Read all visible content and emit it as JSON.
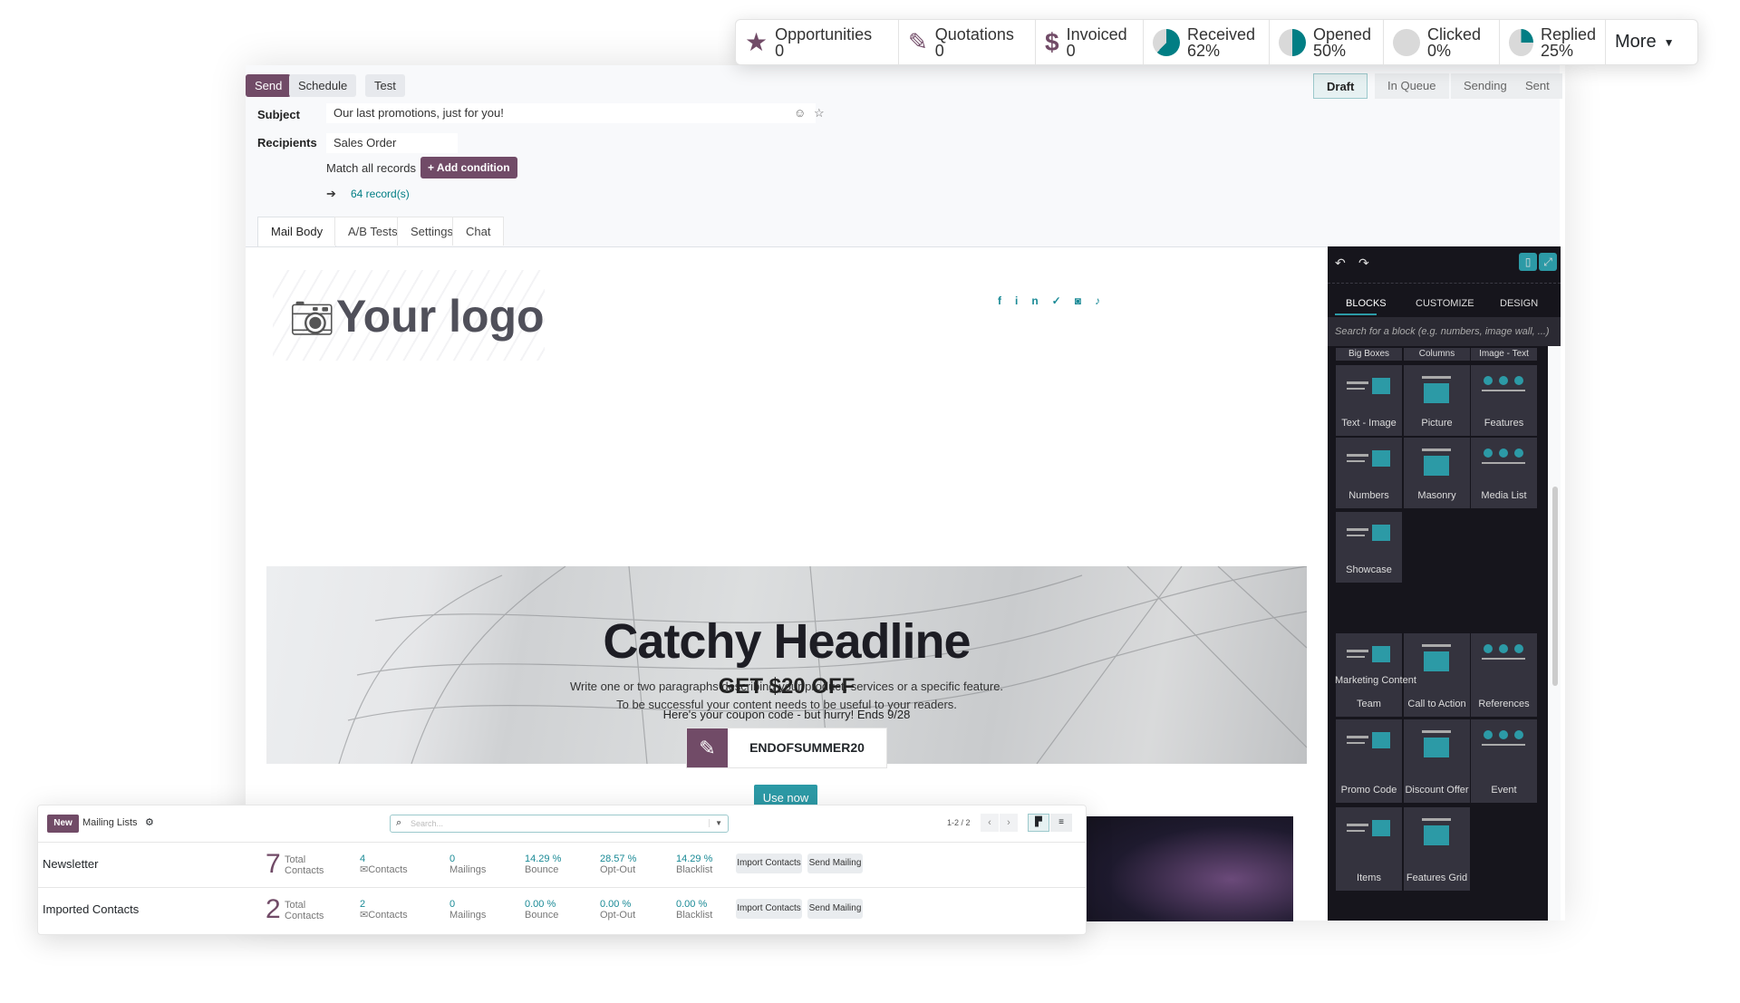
{
  "kpi": [
    {
      "label": "Opportunities",
      "value": "0",
      "icon": "star-icon"
    },
    {
      "label": "Quotations",
      "value": "0",
      "icon": "edit-icon"
    },
    {
      "label": "Invoiced",
      "value": "0",
      "icon": "dollar-icon"
    },
    {
      "label": "Received",
      "value": "62%",
      "pct": 62,
      "icon": "pie-icon"
    },
    {
      "label": "Opened",
      "value": "50%",
      "pct": 50,
      "icon": "pie-icon"
    },
    {
      "label": "Clicked",
      "value": "0%",
      "pct": 0,
      "icon": "pie-icon"
    },
    {
      "label": "Replied",
      "value": "25%",
      "pct": 25,
      "icon": "pie-icon"
    }
  ],
  "kpi_more": "More",
  "toolbar": {
    "send": "Send",
    "schedule": "Schedule",
    "test": "Test"
  },
  "statusbar": [
    "Draft",
    "In Queue",
    "Sending",
    "Sent"
  ],
  "form": {
    "subject_label": "Subject",
    "subject": "Our last promotions, just for you!",
    "recipients_label": "Recipients",
    "recipients": "Sales Order",
    "match": "Match all records",
    "add_condition": "+ Add condition",
    "records": "64 record(s)"
  },
  "tabs": [
    "Mail Body",
    "A/B Tests",
    "Settings",
    "Chat"
  ],
  "mail": {
    "logo": "Your logo",
    "headline": "Catchy Headline",
    "para1": "Write one or two paragraphs describing your product, services or a specific feature.",
    "para2": "To be successful your content needs to be useful to your readers.",
    "offer": "GET $20 OFF",
    "coupon_line": "Here's your coupon code - but hurry! Ends 9/28",
    "code": "ENDOFSUMMER20",
    "cta": "Use now"
  },
  "panel": {
    "tabs": [
      "BLOCKS",
      "CUSTOMIZE",
      "DESIGN"
    ],
    "search_placeholder": "Search for a block (e.g. numbers, image wall, ...)",
    "partial": [
      "Big Boxes",
      "Columns",
      "Image - Text"
    ],
    "structure": [
      "Text - Image",
      "Picture",
      "Features",
      "Numbers",
      "Masonry",
      "Media List",
      "Showcase"
    ],
    "section": "Marketing Content",
    "marketing": [
      "Team",
      "Call to Action",
      "References",
      "Promo Code",
      "Discount Offer",
      "Event",
      "Items",
      "Features Grid"
    ]
  },
  "mailing": {
    "new": "New",
    "title": "Mailing Lists",
    "search_placeholder": "Search...",
    "pager": "1-2 / 2",
    "rows": [
      {
        "name": "Newsletter",
        "total": "7",
        "total_label": "Total Contacts",
        "contacts": "4",
        "contacts_label": "Contacts",
        "mailings": "0",
        "mailings_label": "Mailings",
        "bounce": "14.29 %",
        "bounce_label": "Bounce",
        "optout": "28.57 %",
        "optout_label": "Opt-Out",
        "blacklist": "14.29 %",
        "blacklist_label": "Blacklist",
        "import": "Import Contacts",
        "send": "Send Mailing"
      },
      {
        "name": "Imported Contacts",
        "total": "2",
        "total_label": "Total Contacts",
        "contacts": "2",
        "contacts_label": "Contacts",
        "mailings": "0",
        "mailings_label": "Mailings",
        "bounce": "0.00 %",
        "bounce_label": "Bounce",
        "optout": "0.00 %",
        "optout_label": "Opt-Out",
        "blacklist": "0.00 %",
        "blacklist_label": "Blacklist",
        "import": "Import Contacts",
        "send": "Send Mailing"
      }
    ]
  },
  "colors": {
    "primary": "#714b67",
    "teal": "#017e84",
    "accent": "#2c9aa6",
    "panel": "#16151c"
  }
}
